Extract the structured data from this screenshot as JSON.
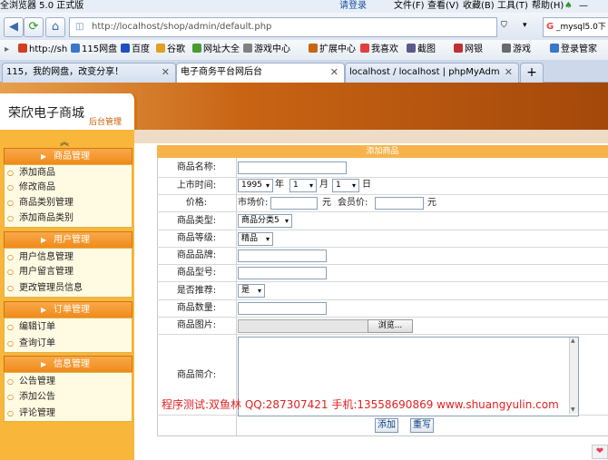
{
  "browser": {
    "title": "全浏览器 5.0 正式版",
    "login": "请登录",
    "menus": [
      "文件(F)",
      "查看(V)",
      "收藏(B)",
      "工具(T)",
      "帮助(H)"
    ],
    "url": "http://localhost/shop/admin/default.php",
    "search_text": "_mysql5.0下",
    "bookmarks": [
      "http://sh",
      "115网盘",
      "百度",
      "谷歌",
      "网址大全",
      "游戏中心",
      "扩展中心",
      "我喜欢",
      "截图",
      "网银",
      "游戏",
      "登录管家"
    ],
    "tabs": [
      "115，我的网盘，改变分享！",
      "电子商务平台网后台",
      "localhost / localhost | phpMyAdm"
    ]
  },
  "site": {
    "name": "荣欣电子商城",
    "sub": "后台管理"
  },
  "sidebar": {
    "groups": [
      {
        "title": "商品管理",
        "items": [
          "添加商品",
          "修改商品",
          "商品类别管理",
          "添加商品类别"
        ]
      },
      {
        "title": "用户管理",
        "items": [
          "用户信息管理",
          "用户留言管理",
          "更改管理员信息"
        ]
      },
      {
        "title": "订单管理",
        "items": [
          "编辑订单",
          "查询订单"
        ]
      },
      {
        "title": "信息管理",
        "items": [
          "公告管理",
          "添加公告",
          "评论管理"
        ]
      }
    ]
  },
  "form": {
    "header": "添加商品",
    "labels": [
      "商品名称:",
      "上市时间:",
      "价格:",
      "商品类型:",
      "商品等级:",
      "商品品牌:",
      "商品型号:",
      "是否推荐:",
      "商品数量:",
      "商品图片:",
      "商品简介:"
    ],
    "date": {
      "year": "1995",
      "year_unit": "年",
      "month": "1",
      "month_unit": "月",
      "day": "1",
      "day_unit": "日"
    },
    "price": {
      "market_label": "市场价:",
      "member_label": "会员价:",
      "unit": "元"
    },
    "type_value": "商品分类5",
    "level_value": "精品",
    "recommend_value": "是",
    "browse_label": "浏览...",
    "submit_label": "添加",
    "reset_label": "重写",
    "watermark": "程序测试:双鱼林 QQ:287307421 手机:13558690869 www.shuangyulin.com"
  },
  "colors": {
    "sidebar": "#f8b63a",
    "group_header": "#f08a1a",
    "banner": "#c86414",
    "form_header": "#f7b34a",
    "watermark": "#e02222"
  }
}
